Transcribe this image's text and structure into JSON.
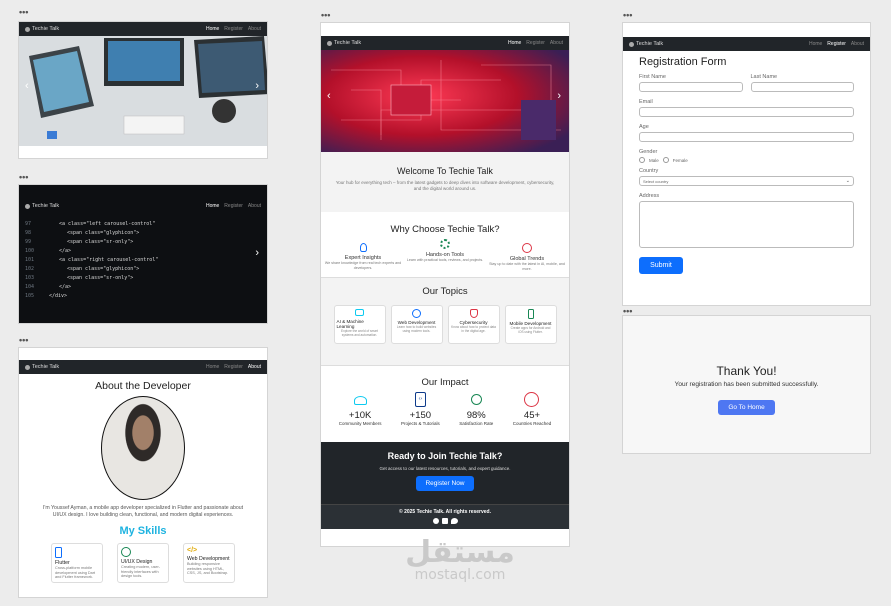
{
  "nav": {
    "brand": "Techie Talk",
    "home": "Home",
    "register": "Register",
    "about": "About"
  },
  "home": {
    "welcome_title": "Welcome To Techie Talk",
    "welcome_text": "Your hub for everything tech – from the latest gadgets to deep dives into software development, cybersecurity, and the digital world around us.",
    "why_title": "Why Choose Techie Talk?",
    "features": [
      {
        "title": "Expert Insights",
        "text": "We share knowledge from real tech experts and developers."
      },
      {
        "title": "Hands-on Tools",
        "text": "Learn with practical tools, reviews, and projects."
      },
      {
        "title": "Global Trends",
        "text": "Stay up to date with the latest in AI, mobile, and more."
      }
    ],
    "topics_title": "Our Topics",
    "topics": [
      {
        "title": "AI & Machine Learning",
        "text": "Explore the world of smart systems and automation."
      },
      {
        "title": "Web Development",
        "text": "Learn how to build websites using modern tools."
      },
      {
        "title": "Cybersecurity",
        "text": "Know about how to protect data in the digital age."
      },
      {
        "title": "Mobile Development",
        "text": "Create apps for Android and iOS using Flutter."
      }
    ],
    "impact_title": "Our Impact",
    "impact": [
      {
        "value": "+10K",
        "label": "Community Members"
      },
      {
        "value": "+150",
        "label": "Projects & Tutorials"
      },
      {
        "value": "98%",
        "label": "Satisfaction Rate"
      },
      {
        "value": "45+",
        "label": "Countries Reached"
      }
    ],
    "cta_title": "Ready to Join Techie Talk?",
    "cta_text": "Get access to our latest resources, tutorials, and expert guidance.",
    "cta_button": "Register Now",
    "footer": "© 2025 Techie Talk. All rights reserved."
  },
  "about": {
    "title": "About the Developer",
    "bio": "I'm Youssef Ayman, a mobile app developer specialized in Flutter and passionate about UI/UX design. I love building clean, functional, and modern digital experiences.",
    "skills_title": "My Skills",
    "skills": [
      {
        "title": "Flutter",
        "text": "Cross-platform mobile development using Dart and Flutter framework."
      },
      {
        "title": "UI/UX Design",
        "text": "Creating modern, user-friendly interfaces with design tools."
      },
      {
        "title": "Web Development",
        "text": "Building responsive websites using HTML, CSS, JS, and Bootstrap."
      }
    ]
  },
  "register": {
    "title": "Registration Form",
    "first_name": "First Name",
    "last_name": "Last Name",
    "email": "Email",
    "age": "Age",
    "gender": "Gender",
    "male": "Male",
    "female": "Female",
    "country": "Country",
    "country_placeholder": "Select country",
    "address": "Address",
    "submit": "Submit"
  },
  "thanks": {
    "title": "Thank You!",
    "text": "Your registration has been submitted successfully.",
    "button": "Go To Home"
  },
  "watermark": {
    "arabic": "مستقل",
    "latin": "mostaql.com"
  },
  "colors": {
    "accent": "#0d6efd",
    "skills_title": "#1fb3e0",
    "nav_bg": "#212529"
  }
}
